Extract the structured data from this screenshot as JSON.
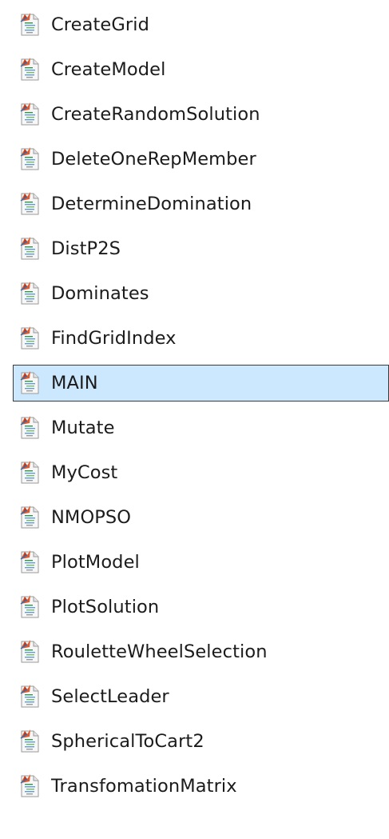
{
  "file_list": {
    "icon_name": "matlab-script-file-icon",
    "selected_index": 8,
    "items": [
      {
        "name": "CreateGrid"
      },
      {
        "name": "CreateModel"
      },
      {
        "name": "CreateRandomSolution"
      },
      {
        "name": "DeleteOneRepMember"
      },
      {
        "name": "DetermineDomination"
      },
      {
        "name": "DistP2S"
      },
      {
        "name": "Dominates"
      },
      {
        "name": "FindGridIndex"
      },
      {
        "name": "MAIN"
      },
      {
        "name": "Mutate"
      },
      {
        "name": "MyCost"
      },
      {
        "name": "NMOPSO"
      },
      {
        "name": "PlotModel"
      },
      {
        "name": "PlotSolution"
      },
      {
        "name": "RouletteWheelSelection"
      },
      {
        "name": "SelectLeader"
      },
      {
        "name": "SphericalToCart2"
      },
      {
        "name": "TransfomationMatrix"
      }
    ]
  },
  "colors": {
    "selection_background": "#cce8ff",
    "selection_border": "#3b3b3b",
    "text": "#1b1b1b"
  }
}
